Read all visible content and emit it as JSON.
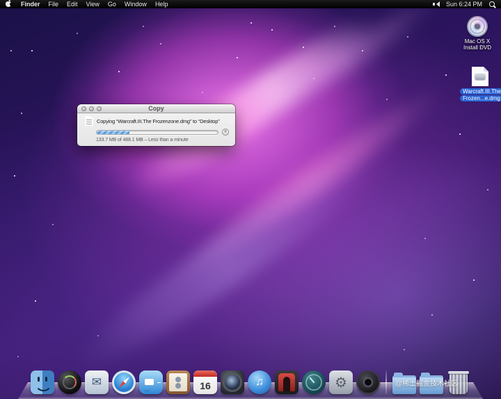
{
  "menu_bar": {
    "items": [
      "Finder",
      "File",
      "Edit",
      "View",
      "Go",
      "Window",
      "Help"
    ],
    "clock": "Sun 6:24 PM"
  },
  "icons": {
    "mail_glyph": "✉",
    "itunes_glyph": "♫",
    "system_preferences_glyph": "⚙",
    "stop_glyph": "×"
  },
  "desktop_icons": {
    "install_dvd": {
      "label_line1": "Mac OS X",
      "label_line2": "Install DVD"
    },
    "dmg_file": {
      "label_line1": "Warcraft.III.The",
      "label_line2": "Frozen...e.dmg",
      "selected": true
    }
  },
  "copy_window": {
    "title": "Copy",
    "message": "Copying “Warcraft.III.The Frozenzone.dmg” to “Desktop”",
    "progress_percent": 27,
    "status": "133.7 MB of 488.1 MB – Less than a minute"
  },
  "dock": {
    "calendar_day": "16",
    "items": [
      "finder",
      "dashboard",
      "mail",
      "safari",
      "ichat",
      "address-book",
      "ical",
      "iphoto",
      "itunes",
      "photo-booth",
      "time-machine",
      "system-preferences",
      "dvd-player",
      "documents-folder",
      "downloads-folder",
      "trash"
    ]
  },
  "watermark": "@稀土掘金技术社区"
}
